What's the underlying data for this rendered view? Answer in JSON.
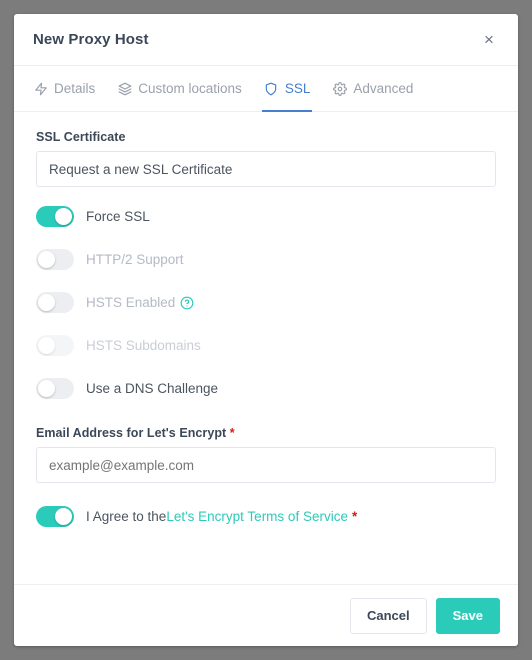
{
  "modal": {
    "title": "New Proxy Host",
    "close_icon": "close-icon",
    "close_label": "×"
  },
  "tabs": [
    {
      "label": "Details",
      "icon": "lightning-bolt-icon",
      "active": false
    },
    {
      "label": "Custom locations",
      "icon": "layers-icon",
      "active": false
    },
    {
      "label": "SSL",
      "icon": "shield-icon",
      "active": true
    },
    {
      "label": "Advanced",
      "icon": "gear-icon",
      "active": false
    }
  ],
  "ssl_certificate": {
    "label": "SSL Certificate",
    "value": "Request a new SSL Certificate"
  },
  "toggles": [
    {
      "label": "Force SSL",
      "on": true,
      "disabled": false,
      "help": false
    },
    {
      "label": "HTTP/2 Support",
      "on": false,
      "disabled": false,
      "help": false
    },
    {
      "label": "HSTS Enabled",
      "on": false,
      "disabled": false,
      "help": true,
      "help_icon": "help-circle-icon"
    },
    {
      "label": "HSTS Subdomains",
      "on": false,
      "disabled": true,
      "help": false
    },
    {
      "label": "Use a DNS Challenge",
      "on": false,
      "disabled": false,
      "help": false
    }
  ],
  "email": {
    "label": "Email Address for Let's Encrypt",
    "required_mark": "*",
    "placeholder": "example@example.com",
    "value": ""
  },
  "terms": {
    "on": true,
    "prefix": "I Agree to the ",
    "link_text": "Let's Encrypt Terms of Service",
    "required_mark": "*"
  },
  "footer": {
    "cancel_label": "Cancel",
    "save_label": "Save"
  },
  "colors": {
    "accent_teal": "#2bcbba",
    "accent_blue": "#467fcf",
    "required_red": "#cd201f",
    "text_dark": "#3c4858",
    "text_muted": "#9aa0ac",
    "backdrop": "#7c7c7c"
  }
}
